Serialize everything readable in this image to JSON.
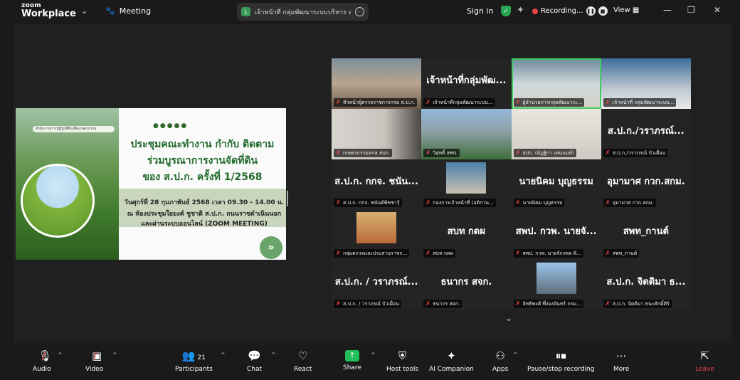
{
  "app": {
    "brand_top": "zoom",
    "brand_bottom": "Workplace",
    "meeting_label": "Meeting"
  },
  "title_bar": {
    "meeting_title": "เจ้าหน้าที่ กลุ่มพัฒนาระบบบริหาร ส.ป.ก.",
    "signin": "Sign in",
    "recording": "Recording...",
    "view": "View"
  },
  "slide": {
    "tag": "สำนักงานการปฏิรูปที่ดินเพื่อเกษตรกรรม",
    "line1": "ประชุมคณะทำงาน กำกับ ติดตาม",
    "line2": "ร่วมบูรณาการงานจัดที่ดิน",
    "line3": "ของ ส.ป.ก. ครั้งที่ 1/2568",
    "date1": "วันศุกร์ที่ 28 กุมภาพันธ์ 2568 เวลา 09.30 - 14.00 น.",
    "date2": "ณ ห้องประชุมใยยงค์ ชูชาติ ส.ป.ก. ถนนราชดำเนินนอก",
    "date3": "และผ่านระบบออนไลน์ (ZOOM MEETING)"
  },
  "participants": [
    {
      "big": "",
      "label": "หัวหน้าผู้ตรวจราชการกรม ส.ป.ก."
    },
    {
      "big": "เจ้าหน้าที่กลุ่มพัฒ...",
      "label": "เจ้าหน้าที่กลุ่มพัฒนาระบบ..."
    },
    {
      "big": "",
      "label": "ผู้อำนวยการกลุ่มพัฒนาระ..."
    },
    {
      "big": "",
      "label": "เจ้าหน้าที่ กลุ่มพัฒนาระบบ..."
    },
    {
      "big": "",
      "label": "เกษตรกรรมสกล สบก."
    },
    {
      "big": "",
      "label": "วิสุทธิ์ สพป."
    },
    {
      "big": "",
      "label": "สปก. (มัฏฐิกา เคนนนท์)"
    },
    {
      "big": "ส.ป.ก./วราภรณ์...",
      "label": "ส.ป.ก./วราภรณ์ บัวเผื่อน"
    },
    {
      "big": "ส.ป.ก. กกจ. ชนัน...",
      "label": "ส.ป.ก. กกจ. ชนันต์พิชชารุ้"
    },
    {
      "big": "",
      "label": "กองการเจ้าหน้าที่ (อติกาน..."
    },
    {
      "big": "นายนิคม บุญธรรม",
      "label": "นายนิคม บุญธรรม"
    },
    {
      "big": "อุมามาศ กวก.สกม.",
      "label": "อุมามาศ กวก.สกม."
    },
    {
      "big": "",
      "label": "กลุ่มตรวจและประสานราชก..."
    },
    {
      "big": "สบท กดผ",
      "label": "สบท กดผ"
    },
    {
      "big": "สพป. กวพ. นายจั...",
      "label": "สพป. กวพ. นายจักรพล พิ..."
    },
    {
      "big": "สพท_กานต์",
      "label": "สพท_กานต์"
    },
    {
      "big": "ส.ป.ก. / วราภรณ์...",
      "label": "ส.ป.ก. / วราภรณ์ บัวเผื่อน"
    },
    {
      "big": "ธนากร สจก.",
      "label": "ธนากร สจก."
    },
    {
      "big": "",
      "label": "สิทธิพงศ์ พึ่งจงจันทร์ กรม..."
    },
    {
      "big": "ส.ป.ก. จิตติมา ธ...",
      "label": "ส.ป.ก. จิตติมา ธนะศักดิ์ศิริ"
    }
  ],
  "toolbar": {
    "audio": "Audio",
    "video": "Video",
    "participants": "Participants",
    "participants_count": "21",
    "chat": "Chat",
    "react": "React",
    "share": "Share",
    "host_tools": "Host tools",
    "ai": "AI Companion",
    "apps": "Apps",
    "record": "Pause/stop recording",
    "more": "More",
    "leave": "Leave"
  }
}
